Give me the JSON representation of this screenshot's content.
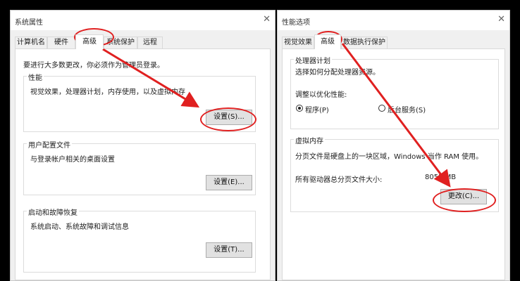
{
  "left_window": {
    "title": "系统属性",
    "close_glyph": "✕",
    "tabs": [
      "计算机名",
      "硬件",
      "高级",
      "系统保护",
      "远程"
    ],
    "notice": "要进行大多数更改，你必须作为管理员登录。",
    "performance": {
      "title": "性能",
      "description": "视觉效果，处理器计划，内存使用，以及虚拟内存",
      "button": "设置(S)..."
    },
    "user_profiles": {
      "title": "用户配置文件",
      "description": "与登录帐户相关的桌面设置",
      "button": "设置(E)..."
    },
    "startup_recovery": {
      "title": "启动和故障恢复",
      "description": "系统启动、系统故障和调试信息",
      "button": "设置(T)..."
    }
  },
  "right_window": {
    "title": "性能选项",
    "close_glyph": "✕",
    "tabs": [
      "视觉效果",
      "高级",
      "数据执行保护"
    ],
    "processor_scheduling": {
      "title": "处理器计划",
      "description": "选择如何分配处理器资源。",
      "adjust_label": "调整以优化性能:",
      "option_programs": "程序(P)",
      "option_services": "后台服务(S)",
      "selected": "程序(P)"
    },
    "virtual_memory": {
      "title": "虚拟内存",
      "description": "分页文件是硬盘上的一块区域，Windows 当作 RAM 使用。",
      "total_label": "所有驱动器总分页文件大小:",
      "total_value": "8052 MB",
      "button": "更改(C)..."
    }
  },
  "annotations": {
    "highlight_color": "#e02020"
  }
}
